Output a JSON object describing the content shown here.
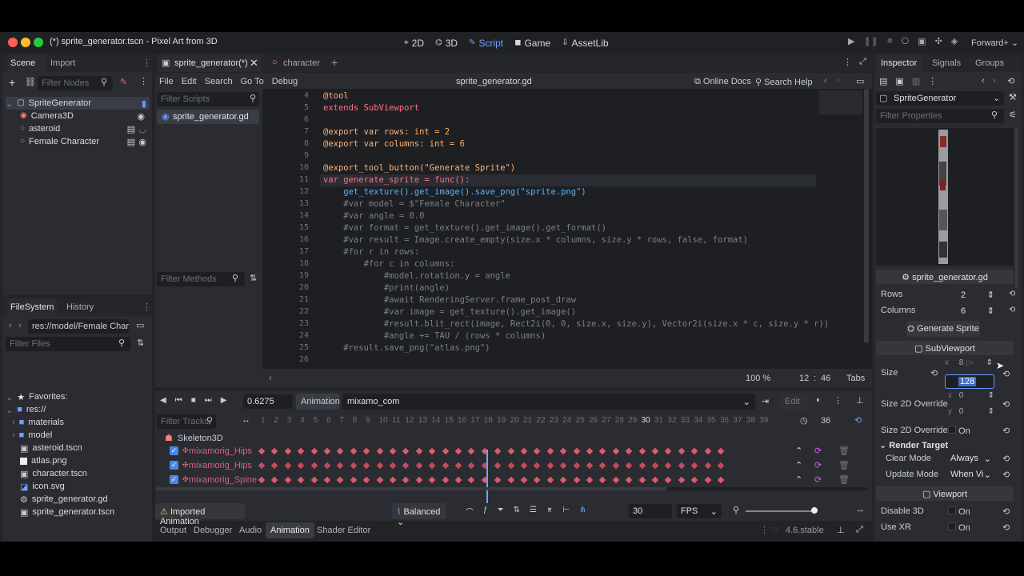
{
  "window": {
    "title": "(*) sprite_generator.tscn - Pixel Art from 3D",
    "renderer": "Forward+"
  },
  "main_tabs": [
    {
      "label": "2D",
      "icon": "2d-icon",
      "active": false
    },
    {
      "label": "3D",
      "icon": "3d-icon",
      "active": false
    },
    {
      "label": "Script",
      "icon": "script-icon",
      "active": true
    },
    {
      "label": "Game",
      "icon": "game-icon",
      "active": false
    },
    {
      "label": "AssetLib",
      "icon": "assetlib-icon",
      "active": false
    }
  ],
  "scene_dock": {
    "tabs": [
      "Scene",
      "Import"
    ],
    "filter_placeholder": "Filter Nodes",
    "nodes": [
      {
        "label": "SpriteGenerator",
        "icon": "subviewport-icon",
        "depth": 0,
        "color": "#cfd3da"
      },
      {
        "label": "Camera3D",
        "icon": "camera-icon",
        "depth": 1,
        "color": "#fc7f7f"
      },
      {
        "label": "asteroid",
        "icon": "node3d-icon",
        "depth": 1,
        "color": "#fc7f7f"
      },
      {
        "label": "Female Character",
        "icon": "node3d-icon",
        "depth": 1,
        "color": "#fc7f7f"
      }
    ]
  },
  "filesystem": {
    "tabs": [
      "FileSystem",
      "History"
    ],
    "path": "res://model/Female Chara",
    "filter_placeholder": "Filter Files",
    "favorites_label": "Favorites:",
    "root": "res://",
    "items": [
      {
        "label": "materials",
        "type": "folder"
      },
      {
        "label": "model",
        "type": "folder"
      },
      {
        "label": "asteroid.tscn",
        "type": "scene"
      },
      {
        "label": "atlas.png",
        "type": "image"
      },
      {
        "label": "character.tscn",
        "type": "scene"
      },
      {
        "label": "icon.svg",
        "type": "image"
      },
      {
        "label": "sprite_generator.gd",
        "type": "script"
      },
      {
        "label": "sprite_generator.tscn",
        "type": "scene"
      }
    ]
  },
  "editor_tabs": [
    {
      "label": "sprite_generator(*)",
      "active": true
    },
    {
      "label": "character",
      "active": false
    }
  ],
  "script_menu": [
    "File",
    "Edit",
    "Search",
    "Go To",
    "Debug"
  ],
  "script_file": "sprite_generator.gd",
  "script_actions": {
    "online_docs": "Online Docs",
    "search_help": "Search Help"
  },
  "scripts_list": {
    "filter_placeholder": "Filter Scripts",
    "items": [
      "sprite_generator.gd"
    ],
    "methods_placeholder": "Filter Methods"
  },
  "code": [
    {
      "n": "4",
      "text": "@tool",
      "cls": "ann"
    },
    {
      "n": "5",
      "text": "extends SubViewport",
      "cls": "kw"
    },
    {
      "n": "6",
      "text": "",
      "cls": "plain"
    },
    {
      "n": "7",
      "text": "@export var rows: int = 2",
      "cls": "ann"
    },
    {
      "n": "8",
      "text": "@export var columns: int = 6",
      "cls": "ann"
    },
    {
      "n": "9",
      "text": "",
      "cls": "plain"
    },
    {
      "n": "10",
      "text": "@export_tool_button(\"Generate Sprite\")",
      "cls": "ann"
    },
    {
      "n": "11",
      "text": "var generate_sprite = func():",
      "cls": "kw"
    },
    {
      "n": "12",
      "text": "    get_texture().get_image().save_png(\"sprite.png\")",
      "cls": "fn"
    },
    {
      "n": "13",
      "text": "    #var model = $\"Female Character\"",
      "cls": "cm"
    },
    {
      "n": "14",
      "text": "    #var angle = 0.0",
      "cls": "cm"
    },
    {
      "n": "15",
      "text": "    #var format = get_texture().get_image().get_format()",
      "cls": "cm"
    },
    {
      "n": "16",
      "text": "    #var result = Image.create_empty(size.x * columns, size.y * rows, false, format)",
      "cls": "cm"
    },
    {
      "n": "17",
      "text": "    #for r in rows:",
      "cls": "cm"
    },
    {
      "n": "18",
      "text": "        #for c in columns:",
      "cls": "cm"
    },
    {
      "n": "19",
      "text": "            #model.rotation.y = angle",
      "cls": "cm"
    },
    {
      "n": "20",
      "text": "            #print(angle)",
      "cls": "cm"
    },
    {
      "n": "21",
      "text": "            #await RenderingServer.frame_post_draw",
      "cls": "cm"
    },
    {
      "n": "22",
      "text": "            #var image = get_texture().get_image()",
      "cls": "cm"
    },
    {
      "n": "23",
      "text": "            #result.blit_rect(image, Rect2i(0, 0, size.x, size.y), Vector2i(size.x * c, size.y * r))",
      "cls": "cm"
    },
    {
      "n": "24",
      "text": "            #angle += TAU / (rows * columns)",
      "cls": "cm"
    },
    {
      "n": "25",
      "text": "    #result.save_png(\"atlas.png\")",
      "cls": "cm"
    },
    {
      "n": "26",
      "text": "",
      "cls": "plain"
    }
  ],
  "status": {
    "zoom": "100 %",
    "line": "12",
    "col": "46",
    "indent": "Tabs"
  },
  "animation": {
    "time": "0.6275",
    "label": "Animation",
    "name": "mixamo_com",
    "edit": "Edit",
    "filter_tracks": "Filter Tracks",
    "frame_count": "36",
    "current_frame": 18,
    "timeline_numbers": [
      "1",
      "2",
      "3",
      "4",
      "5",
      "6",
      "7",
      "8",
      "9",
      "10",
      "11",
      "12",
      "13",
      "14",
      "15",
      "16",
      "17",
      "18",
      "19",
      "20",
      "21",
      "22",
      "23",
      "24",
      "25",
      "26",
      "27",
      "28",
      "29",
      "30",
      "31",
      "32",
      "33",
      "34",
      "35",
      "36",
      "37",
      "38",
      "39"
    ],
    "skeleton": "Skeleton3D",
    "tracks": [
      {
        "label": "mixamorig_Hips",
        "checked": true
      },
      {
        "label": "mixamorig_Hips",
        "checked": true
      },
      {
        "label": "mixamorig_Spine",
        "checked": true
      }
    ],
    "warning": "Imported Animation",
    "balanced": "Balanced",
    "fps_value": "30",
    "fps_unit": "FPS"
  },
  "bottom_tabs": [
    {
      "label": "Output",
      "active": false
    },
    {
      "label": "Debugger",
      "active": false
    },
    {
      "label": "Audio",
      "active": false
    },
    {
      "label": "Animation",
      "active": true
    },
    {
      "label": "Shader Editor",
      "active": false
    }
  ],
  "version": "4.6.stable",
  "inspector": {
    "tabs": [
      "Inspector",
      "Signals",
      "Groups"
    ],
    "node": "SpriteGenerator",
    "filter_placeholder": "Filter Properties",
    "script_section": "sprite_generator.gd",
    "rows_label": "Rows",
    "rows_value": "2",
    "columns_label": "Columns",
    "columns_value": "6",
    "generate_button": "Generate Sprite",
    "subviewport_section": "SubViewport",
    "size_label": "Size",
    "size_x": "8",
    "size_x_prefix": "x",
    "size_unit": "px",
    "size_y": "128",
    "size2d_override_label": "Size 2D Override",
    "size2d_x_prefix": "x",
    "size2d_x": "0",
    "size2d_y_prefix": "y",
    "size2d_y": "0",
    "size2d_stretch_label": "Size 2D Override",
    "on_label": "On",
    "render_target_section": "Render Target",
    "clear_mode_label": "Clear Mode",
    "clear_mode_value": "Always",
    "update_mode_label": "Update Mode",
    "update_mode_value": "When Vi",
    "viewport_section": "Viewport",
    "disable3d_label": "Disable 3D",
    "usexr_label": "Use XR"
  },
  "colors": {
    "accent": "#5c9bff",
    "bg": "#232428",
    "panel": "#2b2c31",
    "keyframe": "#e05a6e"
  }
}
